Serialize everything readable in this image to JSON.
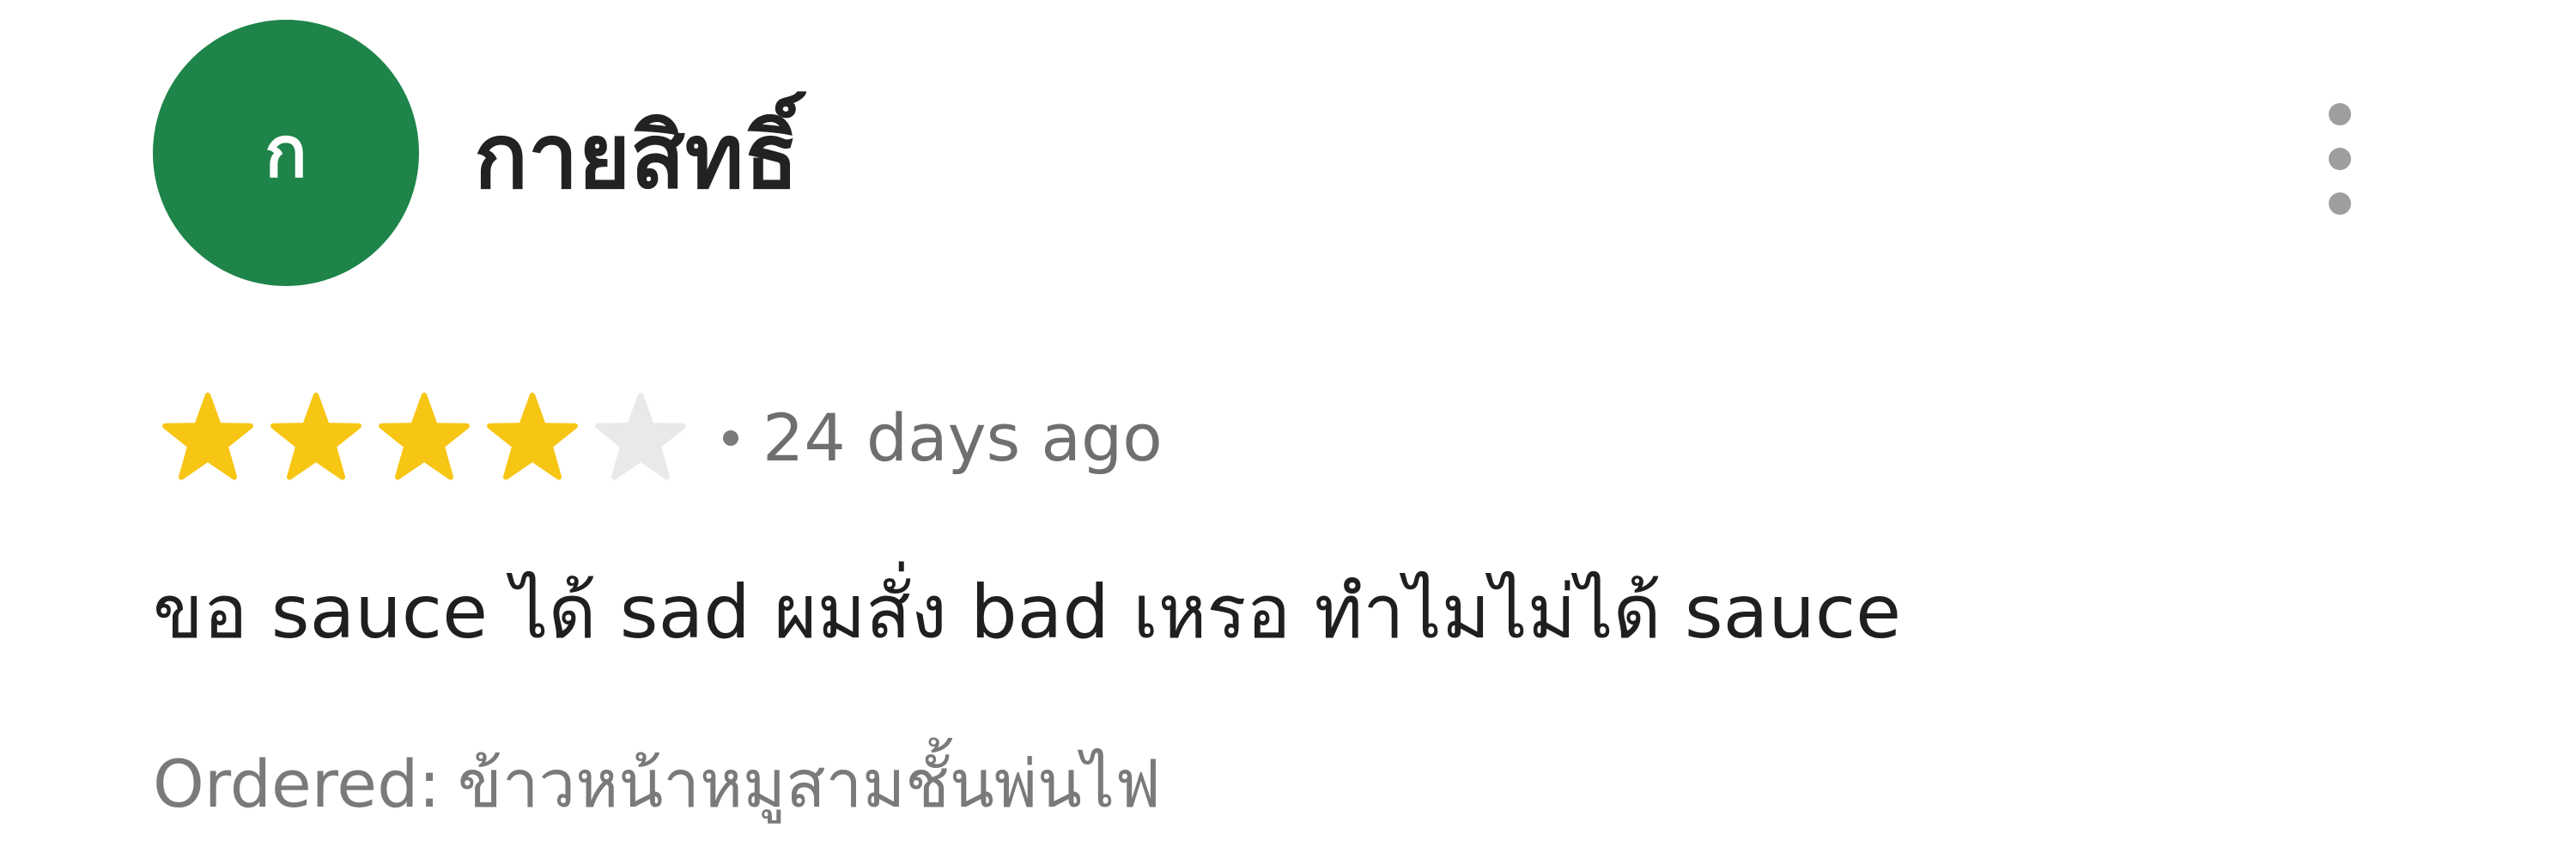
{
  "review": {
    "reviewer": {
      "avatar_initial": "ก",
      "avatar_color": "#1e8449",
      "name": "กายสิทธิ์"
    },
    "menu_icon": "more-vertical-icon",
    "rating": {
      "value": 4,
      "max": 5,
      "filled_color": "#f7c514",
      "empty_color": "#e9e9e9"
    },
    "date": "24 days ago",
    "text": "ขอ sauce ได้ sad ผมสั่ง bad เหรอ ทำไมไม่ได้ sauce",
    "ordered_label": "Ordered:",
    "ordered_item": "ข้าวหน้าหมูสามชั้นพ่นไฟ"
  }
}
